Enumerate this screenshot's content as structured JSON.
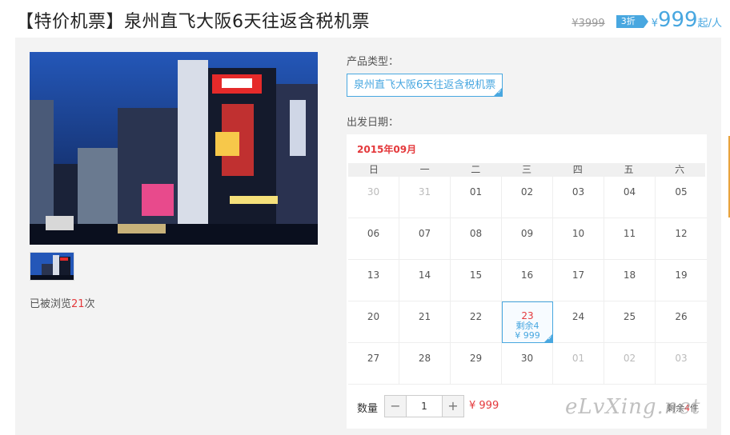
{
  "header": {
    "title": "【特价机票】泉州直飞大阪6天往返含税机票",
    "original_price": "¥3999",
    "discount": "3折",
    "currency": "¥",
    "price": "999",
    "price_unit": "起/人"
  },
  "gallery": {
    "main_image_icon": "city-night-photo",
    "thumbnail_icon": "city-night-thumbnail"
  },
  "views": {
    "prefix": "已被浏览",
    "count": "21",
    "suffix": "次"
  },
  "product": {
    "label": "产品类型：",
    "selected": "泉州直飞大阪6天往返含税机票"
  },
  "date": {
    "label": "出发日期："
  },
  "calendar": {
    "month": "2015年09月",
    "weekdays": [
      "日",
      "一",
      "二",
      "三",
      "四",
      "五",
      "六"
    ],
    "weeks": [
      [
        {
          "d": "30",
          "muted": true
        },
        {
          "d": "31",
          "muted": true
        },
        {
          "d": "01"
        },
        {
          "d": "02"
        },
        {
          "d": "03"
        },
        {
          "d": "04"
        },
        {
          "d": "05"
        }
      ],
      [
        {
          "d": "06"
        },
        {
          "d": "07"
        },
        {
          "d": "08"
        },
        {
          "d": "09"
        },
        {
          "d": "10"
        },
        {
          "d": "11"
        },
        {
          "d": "12"
        }
      ],
      [
        {
          "d": "13"
        },
        {
          "d": "14"
        },
        {
          "d": "15"
        },
        {
          "d": "16"
        },
        {
          "d": "17"
        },
        {
          "d": "18"
        },
        {
          "d": "19"
        }
      ],
      [
        {
          "d": "20"
        },
        {
          "d": "21"
        },
        {
          "d": "22"
        },
        {
          "d": "23",
          "selected": true,
          "remaining": "剩余4",
          "price": "¥ 999"
        },
        {
          "d": "24"
        },
        {
          "d": "25"
        },
        {
          "d": "26"
        }
      ],
      [
        {
          "d": "27"
        },
        {
          "d": "28"
        },
        {
          "d": "29"
        },
        {
          "d": "30"
        },
        {
          "d": "01",
          "muted": true
        },
        {
          "d": "02",
          "muted": true
        },
        {
          "d": "03",
          "muted": true
        }
      ]
    ]
  },
  "quantity": {
    "label": "数量",
    "minus": "−",
    "value": "1",
    "plus": "+",
    "price": "¥ 999",
    "stock_prefix": "剩余",
    "stock_count": "4",
    "stock_suffix": "件"
  },
  "watermark": "eLvXing.net",
  "colors": {
    "accent": "#48a7e0",
    "price_red": "#e4393c",
    "panel_bg": "#f3f3f3"
  }
}
